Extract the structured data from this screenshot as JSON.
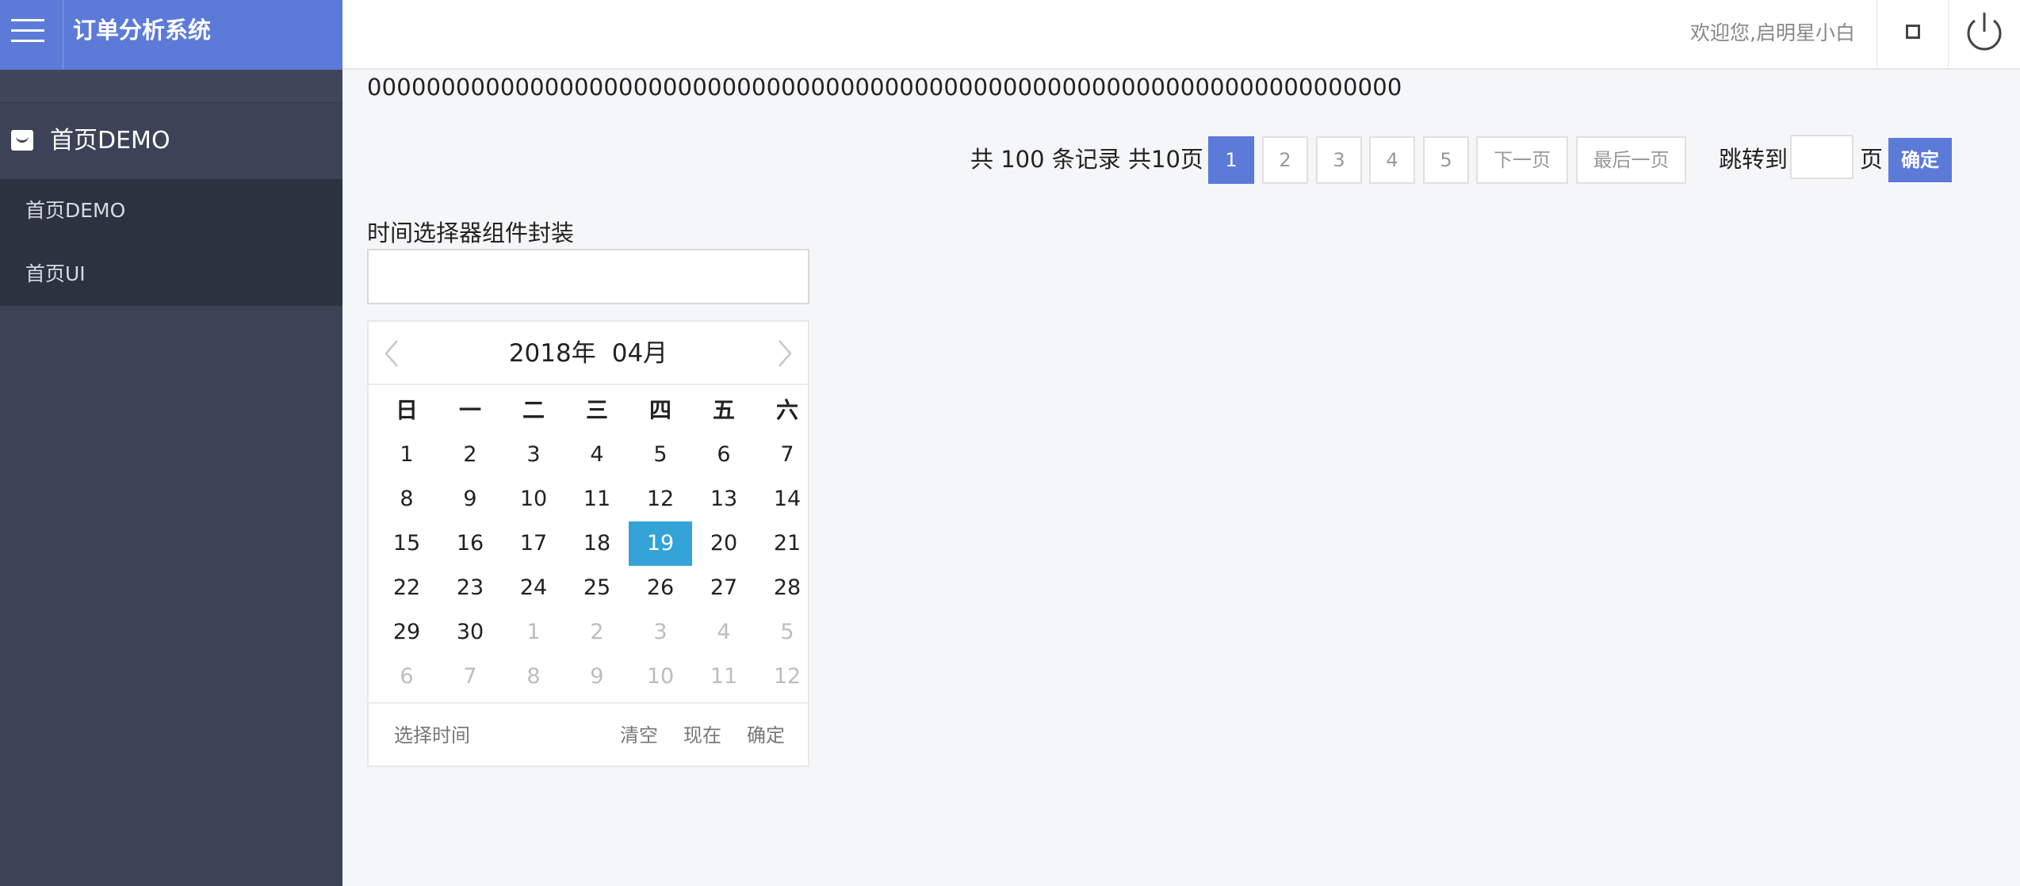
{
  "app": {
    "title": "订单分析系统",
    "welcome": "欢迎您,启明星小白"
  },
  "sidebar": {
    "group_label": "首页DEMO",
    "items": [
      {
        "label": "首页DEMO"
      },
      {
        "label": "首页UI"
      }
    ]
  },
  "main": {
    "zeros_text": "0000000000000000000000000000000000000000000000000000000000000000000000",
    "pager": {
      "summary": "共 100 条记录 共10页",
      "pages": [
        "1",
        "2",
        "3",
        "4",
        "5"
      ],
      "active_page": "1",
      "next_label": "下一页",
      "last_label": "最后一页",
      "jump_prefix": "跳转到",
      "jump_suffix": "页",
      "jump_value": "",
      "confirm_label": "确定"
    },
    "datepicker": {
      "title": "时间选择器组件封装",
      "input_value": "",
      "year": "2018年",
      "month": "04月",
      "weekdays": [
        "日",
        "一",
        "二",
        "三",
        "四",
        "五",
        "六"
      ],
      "days": [
        [
          "1",
          "2",
          "3",
          "4",
          "5",
          "6",
          "7"
        ],
        [
          "8",
          "9",
          "10",
          "11",
          "12",
          "13",
          "14"
        ],
        [
          "15",
          "16",
          "17",
          "18",
          "19",
          "20",
          "21"
        ],
        [
          "22",
          "23",
          "24",
          "25",
          "26",
          "27",
          "28"
        ],
        [
          "29",
          "30",
          "1",
          "2",
          "3",
          "4",
          "5"
        ],
        [
          "6",
          "7",
          "8",
          "9",
          "10",
          "11",
          "12"
        ]
      ],
      "selected_day": "19",
      "footer": {
        "select_time": "选择时间",
        "clear": "清空",
        "now": "现在",
        "confirm": "确定"
      }
    }
  },
  "colors": {
    "brand": "#5c7ad8",
    "sidebar_bg": "#3c4356",
    "sidebar_sub_bg": "#2d3240",
    "selected_day": "#33a3d8"
  },
  "icons": {
    "menu": "hamburger-icon",
    "group": "shopping-bag-icon",
    "fullscreen": "square-icon",
    "logout": "power-icon",
    "prev": "chevron-left-icon",
    "next": "chevron-right-icon"
  }
}
